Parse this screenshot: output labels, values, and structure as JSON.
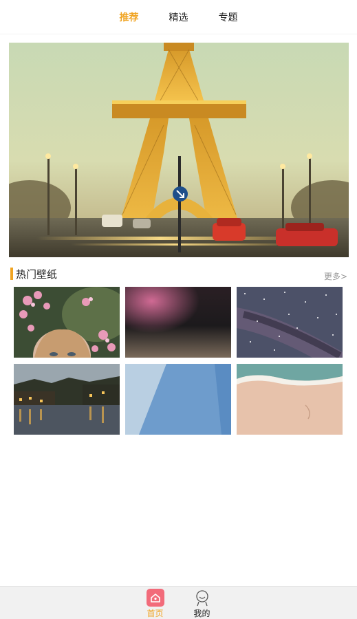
{
  "top_tabs": [
    {
      "label": "推荐",
      "active": true
    },
    {
      "label": "精选",
      "active": false
    },
    {
      "label": "专题",
      "active": false
    }
  ],
  "section": {
    "title": "热门壁纸",
    "more_label": "更多>"
  },
  "bottom_nav": [
    {
      "label": "首页",
      "icon": "home-icon",
      "active": true
    },
    {
      "label": "我的",
      "icon": "user-icon",
      "active": false
    }
  ],
  "colors": {
    "accent": "#f0a422",
    "home_icon": "#f26b7a",
    "nav_bg": "#f1f1f1"
  }
}
